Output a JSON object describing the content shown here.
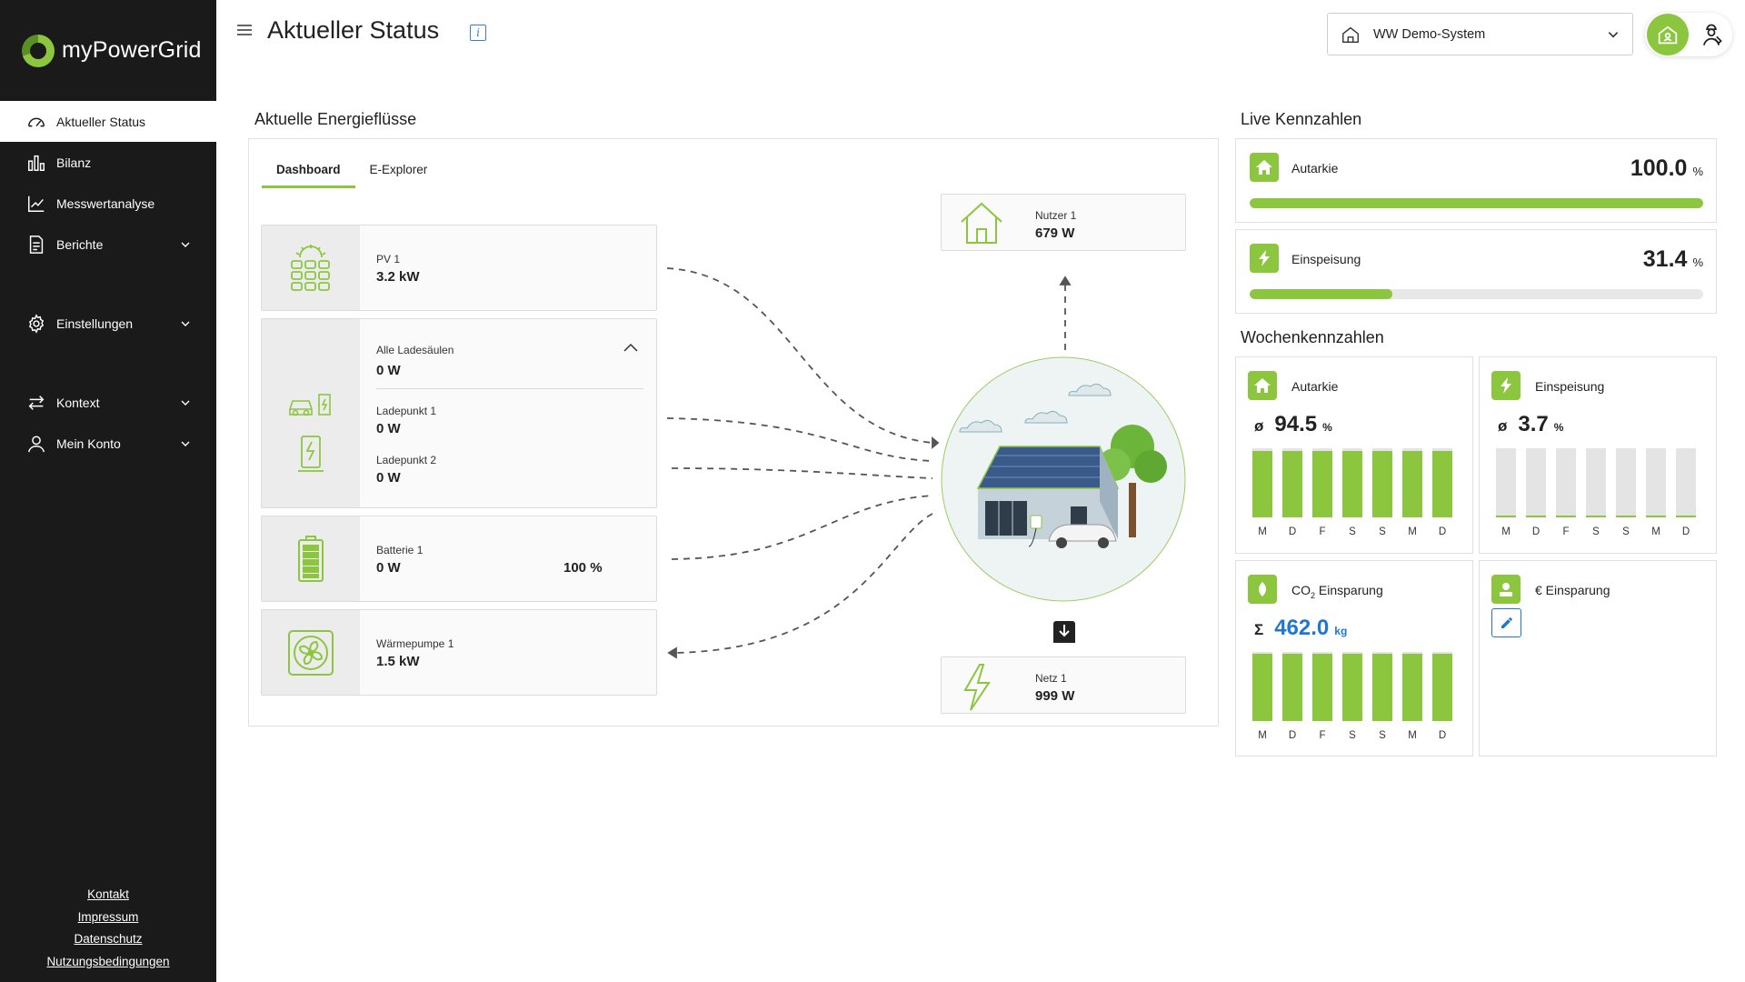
{
  "app": {
    "name": "myPowerGrid"
  },
  "sidebar": {
    "items": [
      {
        "label": "Aktueller Status",
        "icon": "gauge-icon",
        "active": true
      },
      {
        "label": "Bilanz",
        "icon": "bar-chart-icon"
      },
      {
        "label": "Messwertanalyse",
        "icon": "line-chart-icon"
      },
      {
        "label": "Berichte",
        "icon": "document-icon",
        "expandable": true
      },
      {
        "label": "Einstellungen",
        "icon": "gear-icon",
        "expandable": true
      },
      {
        "label": "Kontext",
        "icon": "swap-arrows-icon",
        "expandable": true
      },
      {
        "label": "Mein Konto",
        "icon": "user-icon",
        "expandable": true
      }
    ],
    "footer": [
      "Kontakt",
      "Impressum",
      "Datenschutz",
      "Nutzungsbedingungen"
    ]
  },
  "header": {
    "title": "Aktueller Status",
    "info_glyph": "i",
    "system": "WW Demo-System"
  },
  "flows": {
    "title": "Aktuelle Energieflüsse",
    "tabs": [
      "Dashboard",
      "E-Explorer"
    ],
    "pv": {
      "label": "PV 1",
      "value": "3.2 kW"
    },
    "charging": {
      "label": "Alle Ladesäulen",
      "value": "0 W",
      "points": [
        {
          "label": "Ladepunkt 1",
          "value": "0 W"
        },
        {
          "label": "Ladepunkt 2",
          "value": "0 W"
        }
      ]
    },
    "battery": {
      "label": "Batterie 1",
      "value": "0 W",
      "soc": "100 %"
    },
    "heatpump": {
      "label": "Wärmepumpe 1",
      "value": "1.5 kW"
    },
    "consumer": {
      "label": "Nutzer 1",
      "value": "679 W"
    },
    "grid": {
      "label": "Netz 1",
      "value": "999 W"
    }
  },
  "live": {
    "title": "Live Kennzahlen",
    "autarkie": {
      "label": "Autarkie",
      "value": "100.0",
      "unit": "%",
      "fraction": 1.0
    },
    "einspeisung": {
      "label": "Einspeisung",
      "value": "31.4",
      "unit": "%",
      "fraction": 0.314
    }
  },
  "weekly": {
    "title": "Wochenkennzahlen",
    "days": [
      "M",
      "D",
      "F",
      "S",
      "S",
      "M",
      "D"
    ],
    "autarkie": {
      "label": "Autarkie",
      "symbol": "ø",
      "value": "94.5",
      "unit": "%",
      "bars": [
        0.96,
        0.96,
        0.96,
        0.96,
        0.96,
        0.96,
        0.96
      ]
    },
    "einspeisung": {
      "label": "Einspeisung",
      "symbol": "ø",
      "value": "3.7",
      "unit": "%",
      "bars": [
        0.02,
        0.02,
        0.02,
        0.02,
        0.02,
        0.02,
        0.02
      ]
    },
    "co2": {
      "label_main": "CO",
      "label_sub": "2",
      "label_rest": " Einsparung",
      "symbol": "Σ",
      "value": "462.0",
      "unit": "kg",
      "bars": [
        0.98,
        0.98,
        0.98,
        0.98,
        0.98,
        0.98,
        0.98
      ]
    },
    "euro": {
      "label": "€ Einsparung"
    }
  },
  "colors": {
    "accent": "#8cc63f",
    "sidebar": "#1a1a1a",
    "link_blue": "#1f77d0"
  }
}
